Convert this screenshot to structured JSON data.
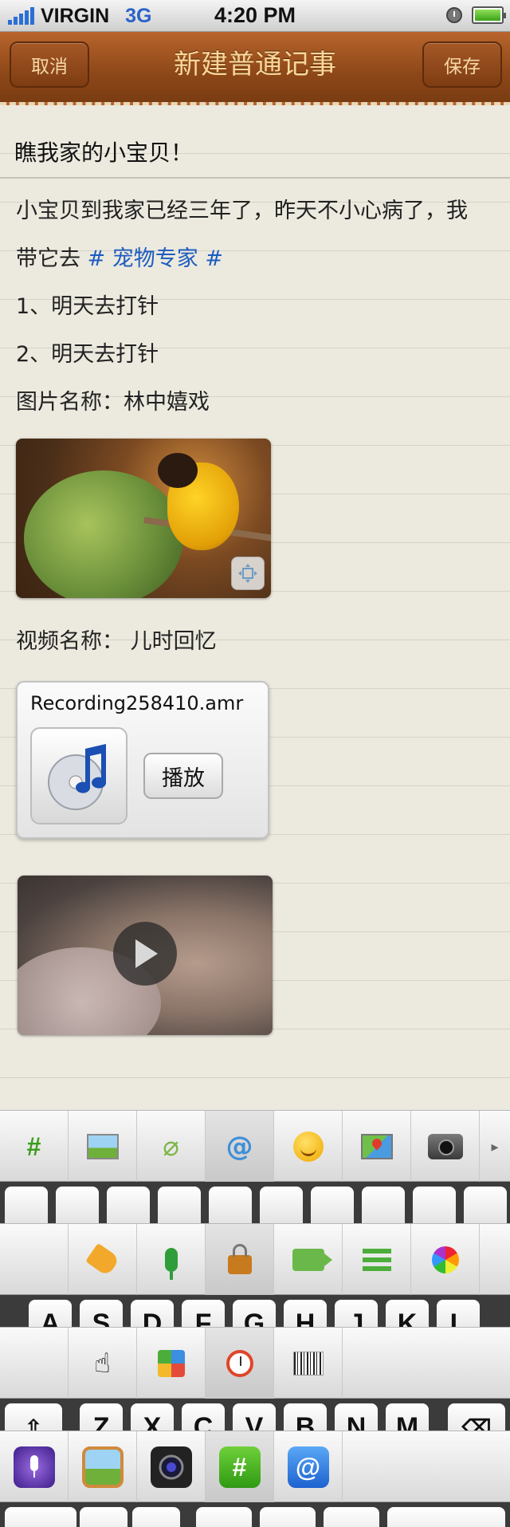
{
  "status_bar": {
    "carrier": "VIRGIN",
    "network": "3G",
    "time": "4:20 PM",
    "battery_level": 1.0
  },
  "nav": {
    "cancel_label": "取消",
    "title": "新建普通记事",
    "save_label": "保存"
  },
  "note": {
    "title": "瞧我家的小宝贝！",
    "body_line1": "小宝贝到我家已经三年了，昨天不小心病了，我",
    "body_line2_prefix": "带它去",
    "body_line2_tag": "# 宠物专家 #",
    "list_item1": "1、明天去打针",
    "list_item2": "2、明天去打针",
    "image_caption": "图片名称：林中嬉戏",
    "video_caption": "视频名称： 儿时回忆",
    "audio": {
      "filename": "Recording258410.amr",
      "play_label": "播放"
    }
  },
  "toolbar_rows": [
    {
      "items": [
        "hashtag-icon",
        "image-icon",
        "paperclip-icon",
        "at-icon",
        "smiley-icon",
        "map-icon",
        "camera-icon",
        "more-arrow-icon"
      ],
      "selected": "at-icon"
    },
    {
      "items": [
        "tag-icon",
        "microphone-icon",
        "lock-icon",
        "video-camera-icon",
        "list-icon",
        "color-wheel-icon"
      ],
      "selected": "lock-icon"
    },
    {
      "items": [
        "hand-pointer-icon",
        "tiles-icon",
        "alarm-clock-icon",
        "barcode-scan-icon"
      ],
      "selected": "alarm-clock-icon"
    },
    {
      "items": [
        "voice-app-icon",
        "photo-app-icon",
        "camera-app-icon",
        "hashtag-app-icon",
        "at-app-icon"
      ],
      "selected": "hashtag-app-icon"
    }
  ],
  "keyboard": {
    "row2": [
      "A",
      "S",
      "D",
      "F",
      "G",
      "H",
      "J",
      "K",
      "L"
    ],
    "row3": [
      "Z",
      "X",
      "C",
      "V",
      "B",
      "N",
      "M"
    ]
  },
  "colors": {
    "nav_leather": "#8d4718",
    "nav_text": "#f8d89a",
    "tag_link": "#1c5dbf",
    "paper": "#ece9df"
  }
}
